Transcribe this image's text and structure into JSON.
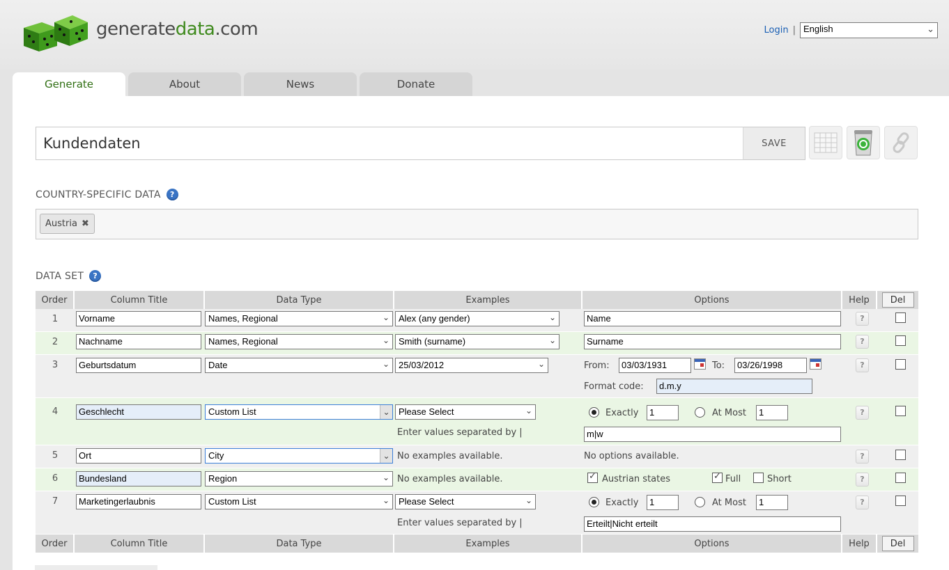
{
  "brand": {
    "name_part1": "generate",
    "name_part2": "data",
    "name_part3": ".com"
  },
  "header": {
    "login_label": "Login",
    "separator": "|",
    "language_value": "English"
  },
  "tabs": [
    {
      "label": "Generate",
      "active": true
    },
    {
      "label": "About",
      "active": false
    },
    {
      "label": "News",
      "active": false
    },
    {
      "label": "Donate",
      "active": false
    }
  ],
  "config": {
    "title_value": "Kundendaten",
    "save_label": "SAVE"
  },
  "country_section": {
    "label": "COUNTRY-SPECIFIC DATA",
    "help_icon": "?",
    "selected_country": "Austria",
    "remove_icon": "✖"
  },
  "dataset_section": {
    "label": "DATA SET",
    "help_icon": "?"
  },
  "columns": {
    "order": "Order",
    "title": "Column Title",
    "type": "Data Type",
    "examples": "Examples",
    "options": "Options",
    "help": "Help",
    "del": "Del"
  },
  "rows": [
    {
      "order": "1",
      "title": "Vorname",
      "type": "Names, Regional",
      "example": "Alex (any gender)",
      "option_value": "Name"
    },
    {
      "order": "2",
      "title": "Nachname",
      "type": "Names, Regional",
      "example": "Smith (surname)",
      "option_value": "Surname"
    },
    {
      "order": "3",
      "title": "Geburtsdatum",
      "type": "Date",
      "example": "25/03/2012",
      "from_label": "From:",
      "from_value": "03/03/1931",
      "to_label": "To:",
      "to_value": "03/26/1998",
      "format_label": "Format code:",
      "format_value": "d.m.y"
    },
    {
      "order": "4",
      "title": "Geschlecht",
      "type": "Custom List",
      "example": "Please Select",
      "hint": "Enter values separated by |",
      "exactly_label": "Exactly",
      "exactly_value": "1",
      "atmost_label": "At Most",
      "atmost_value": "1",
      "list_value": "m|w"
    },
    {
      "order": "5",
      "title": "Ort",
      "type": "City",
      "example_text": "No examples available.",
      "option_text": "No options available."
    },
    {
      "order": "6",
      "title": "Bundesland",
      "type": "Region",
      "example_text": "No examples available.",
      "states_label": "Austrian states",
      "full_label": "Full",
      "short_label": "Short"
    },
    {
      "order": "7",
      "title": "Marketingerlaubnis",
      "type": "Custom List",
      "example": "Please Select",
      "hint": "Enter values separated by |",
      "exactly_label": "Exactly",
      "exactly_value": "1",
      "atmost_label": "At Most",
      "atmost_value": "1",
      "list_value": "Erteilt|Nicht erteilt"
    }
  ],
  "help_glyph": "?"
}
